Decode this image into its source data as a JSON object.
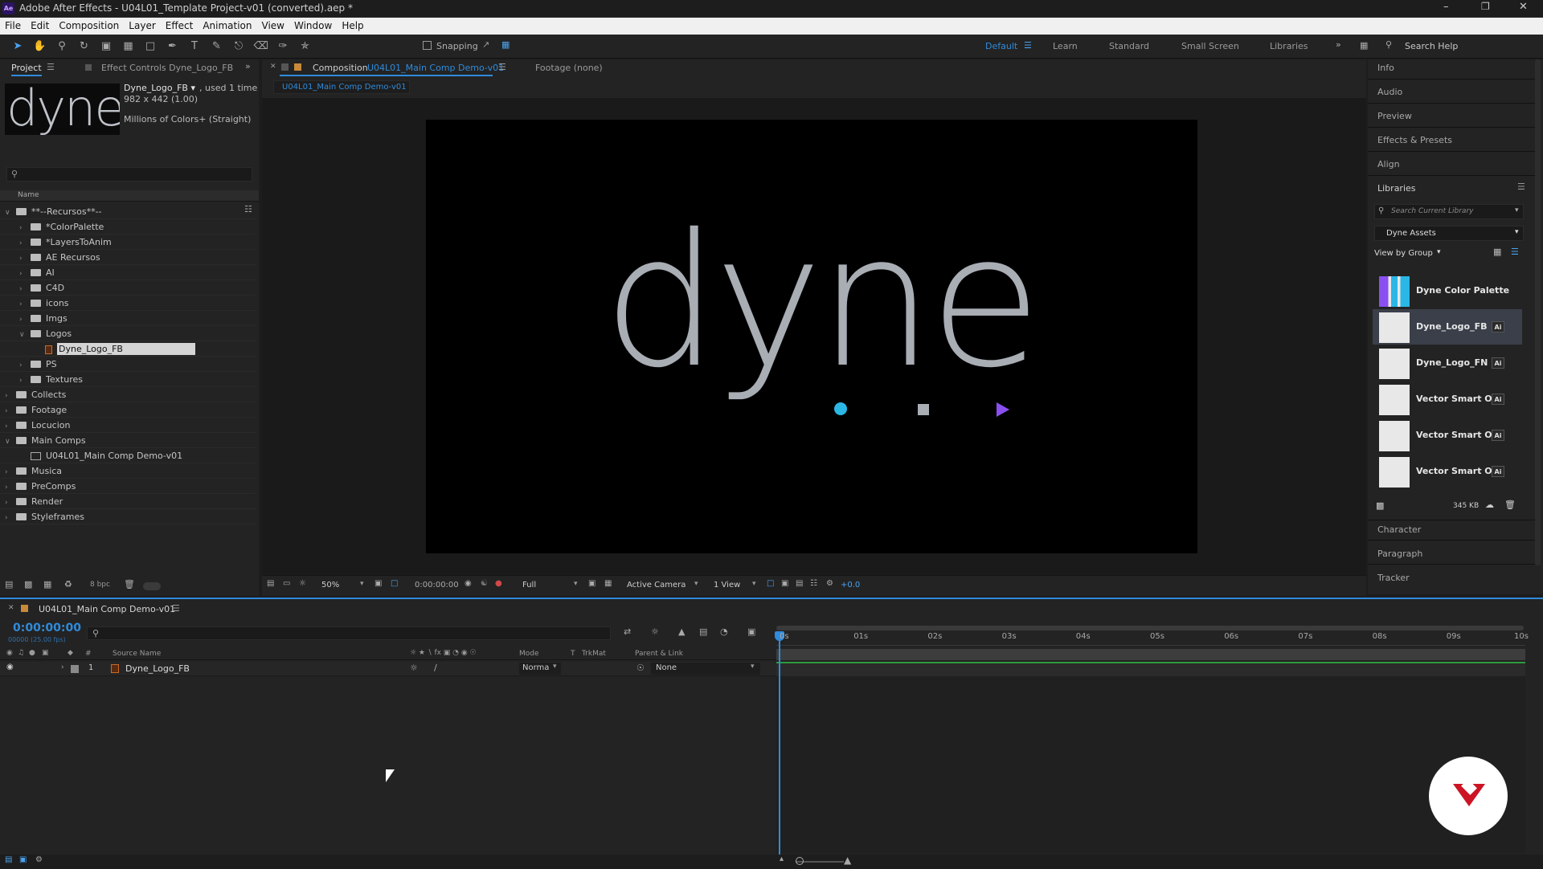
{
  "window": {
    "title": "Adobe After Effects - U04L01_Template Project-v01 (converted).aep *",
    "app_icon": "Ae"
  },
  "menu": [
    "File",
    "Edit",
    "Composition",
    "Layer",
    "Effect",
    "Animation",
    "View",
    "Window",
    "Help"
  ],
  "toolbar": {
    "snapping_label": "Snapping",
    "workspaces": [
      "Default",
      "Learn",
      "Standard",
      "Small Screen",
      "Libraries"
    ],
    "active_workspace": "Default",
    "search_placeholder": "Search Help"
  },
  "project_panel": {
    "tab_project": "Project",
    "tab_effect_controls": "Effect Controls Dyne_Logo_FB",
    "preview": {
      "thumb_text": "dyne",
      "name": "Dyne_Logo_FB ▾",
      "used": ", used 1 time",
      "dims": "982 x 442 (1.00)",
      "colors": "Millions of Colors+ (Straight)"
    },
    "column_name": "Name",
    "items": [
      {
        "label": "**--Recursos**--",
        "level": 0,
        "open": true
      },
      {
        "label": "*ColorPalette",
        "level": 1,
        "open": false
      },
      {
        "label": "*LayersToAnim",
        "level": 1,
        "open": false
      },
      {
        "label": "AE Recursos",
        "level": 1,
        "open": false
      },
      {
        "label": "AI",
        "level": 1,
        "open": false
      },
      {
        "label": "C4D",
        "level": 1,
        "open": false
      },
      {
        "label": "icons",
        "level": 1,
        "open": false
      },
      {
        "label": "Imgs",
        "level": 1,
        "open": false
      },
      {
        "label": "Logos",
        "level": 1,
        "open": true
      },
      {
        "label": "Dyne_Logo_FB",
        "level": 2,
        "file": true,
        "selected": true
      },
      {
        "label": "PS",
        "level": 1,
        "open": false
      },
      {
        "label": "Textures",
        "level": 1,
        "open": false
      },
      {
        "label": "Collects",
        "level": 0,
        "open": false
      },
      {
        "label": "Footage",
        "level": 0,
        "open": false
      },
      {
        "label": "Locucion",
        "level": 0,
        "open": false
      },
      {
        "label": "Main Comps",
        "level": 0,
        "open": true
      },
      {
        "label": "U04L01_Main Comp Demo-v01",
        "level": 1,
        "comp": true
      },
      {
        "label": "Musica",
        "level": 0,
        "open": false
      },
      {
        "label": "PreComps",
        "level": 0,
        "open": false
      },
      {
        "label": "Render",
        "level": 0,
        "open": false
      },
      {
        "label": "Styleframes",
        "level": 0,
        "open": false
      }
    ],
    "bpc": "8 bpc"
  },
  "comp_panel": {
    "tab_composition_prefix": "Composition",
    "tab_composition_name": "U04L01_Main Comp Demo-v01",
    "tab_footage": "Footage (none)",
    "subtab": "U04L01_Main Comp Demo-v01",
    "logo_text": "dyne",
    "bottom": {
      "zoom": "50%",
      "timecode": "0:00:00:00",
      "resolution": "Full",
      "camera": "Active Camera",
      "views": "1 View",
      "exposure": "+0.0"
    }
  },
  "right_panel": {
    "sections_top": [
      "Info",
      "Audio",
      "Preview",
      "Effects & Presets",
      "Align"
    ],
    "libraries_title": "Libraries",
    "search_placeholder": "Search Current Library",
    "library_name": "Dyne Assets",
    "view_by": "View by Group",
    "items": [
      {
        "name": "Dyne Color Palette",
        "badge": ""
      },
      {
        "name": "Dyne_Logo_FB",
        "badge": "Ai",
        "selected": true
      },
      {
        "name": "Dyne_Logo_FN",
        "badge": "Ai"
      },
      {
        "name": "Vector Smart O...",
        "badge": "Ai"
      },
      {
        "name": "Vector Smart O...",
        "badge": "Ai"
      },
      {
        "name": "Vector Smart O...",
        "badge": "Ai"
      }
    ],
    "size": "345 KB",
    "sections_bottom": [
      "Character",
      "Paragraph",
      "Tracker"
    ]
  },
  "timeline": {
    "tab": "U04L01_Main Comp Demo-v01",
    "timecode": "0:00:00:00",
    "frames": "00000 (25.00 fps)",
    "columns": {
      "num": "#",
      "source": "Source Name",
      "mode": "Mode",
      "t": "T",
      "trkmat": "TrkMat",
      "parent": "Parent & Link"
    },
    "ruler": [
      "0s",
      "01s",
      "02s",
      "03s",
      "04s",
      "05s",
      "06s",
      "07s",
      "08s",
      "09s",
      "10s"
    ],
    "layers": [
      {
        "num": "1",
        "name": "Dyne_Logo_FB",
        "mode": "Norma",
        "parent": "None"
      }
    ]
  },
  "colors": {
    "accent_blue": "#2f8bdb",
    "logo_gray": "#a9adb4",
    "logo_cyan": "#2ab7e6",
    "logo_purple": "#8a4ff0"
  }
}
